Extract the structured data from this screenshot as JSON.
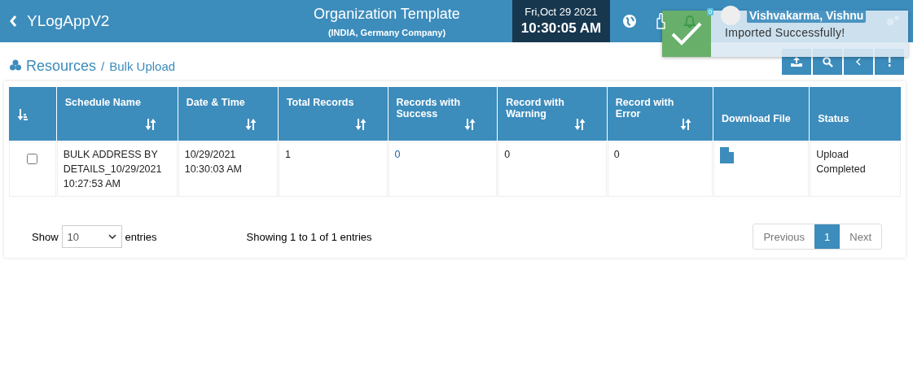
{
  "header": {
    "app_name": "YLogAppV2",
    "title": "Organization Template",
    "subtitle": "(INDIA, Germany Company)",
    "date": "Fri,Oct 29 2021",
    "time": "10:30:05 AM",
    "notification_count": "0",
    "user_name": "Vishvakarma, Vishnu"
  },
  "toast": {
    "message": "Imported Successfully!"
  },
  "breadcrumb": {
    "section": "Resources",
    "separator": "/",
    "page": "Bulk Upload"
  },
  "table": {
    "columns": [
      {
        "kind": "select"
      },
      {
        "label": "Schedule Name",
        "kind": "sortable"
      },
      {
        "label": "Date & Time",
        "kind": "sortable"
      },
      {
        "label": "Total Records",
        "kind": "sortable"
      },
      {
        "label": "Records with Success",
        "kind": "sortable"
      },
      {
        "label": "Record with Warning",
        "kind": "sortable"
      },
      {
        "label": "Record with Error",
        "kind": "sortable"
      },
      {
        "label": "Download File",
        "kind": "plain"
      },
      {
        "label": "Status",
        "kind": "plain"
      }
    ],
    "rows": [
      {
        "checked": false,
        "schedule_name": "BULK ADDRESS BY DETAILS_10/29/2021 10:27:53 AM",
        "date_time": "10/29/2021 10:30:03 AM",
        "total": "1",
        "success": "0",
        "warning": "0",
        "error": "0",
        "status": "Upload Completed"
      }
    ]
  },
  "footer": {
    "show_label": "Show",
    "page_size": "10",
    "entries_label": "entries",
    "info": "Showing 1 to 1 of 1 entries",
    "pages": [
      {
        "label": "Previous",
        "kind": "prev",
        "selected": false
      },
      {
        "label": "1",
        "kind": "page",
        "selected": true
      },
      {
        "label": "Next",
        "kind": "next",
        "selected": false
      }
    ]
  }
}
